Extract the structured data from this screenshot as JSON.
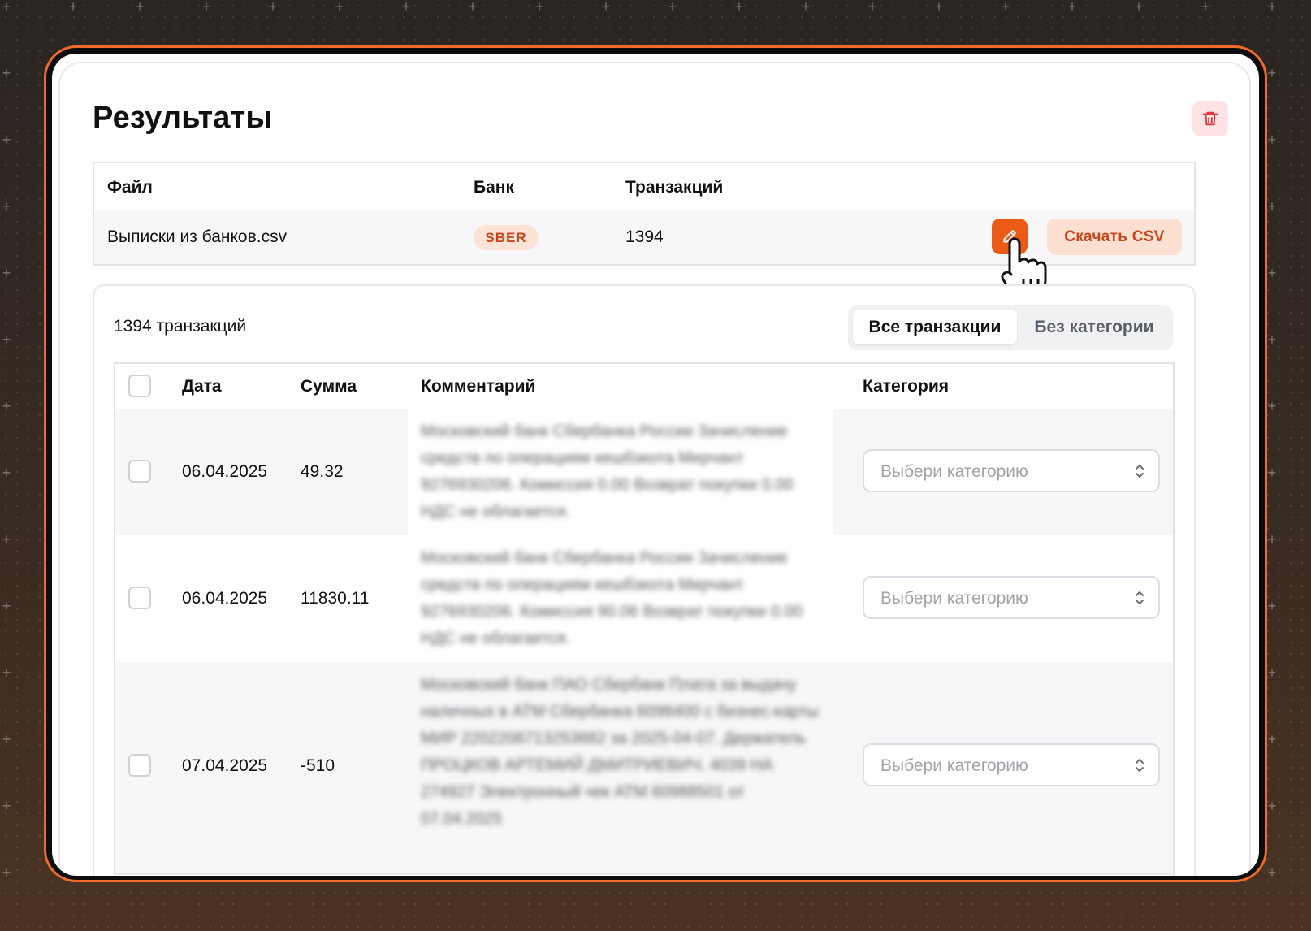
{
  "page": {
    "title": "Результаты"
  },
  "file_table": {
    "columns": [
      "Файл",
      "Банк",
      "Транзакций"
    ],
    "row": {
      "file": "Выписки из банков.csv",
      "bank": "SBER",
      "count": "1394",
      "download_label": "Скачать CSV"
    }
  },
  "transactions": {
    "count_label": "1394 транзакций",
    "tabs": [
      {
        "label": "Все транзакции",
        "active": true
      },
      {
        "label": "Без категории",
        "active": false
      }
    ],
    "columns": [
      "Дата",
      "Сумма",
      "Комментарий",
      "Категория"
    ],
    "rows": [
      {
        "date": "06.04.2025",
        "amount": "49.32",
        "comment": "Московский банк Сбербанка России Зачисление средств по операциям кешбэкота Мерчант 9276930206. Комиссия 0.00 Возврат покупки 0.00 НДС не облагается.",
        "category_placeholder": "Выбери категорию"
      },
      {
        "date": "06.04.2025",
        "amount": "11830.11",
        "comment": "Московский банк Сбербанка России Зачисление средств по операциям кешбэкота Мерчант 9276930206. Комиссия 90.06 Возврат покупки 0.00 НДС не облагается.",
        "category_placeholder": "Выбери категорию"
      },
      {
        "date": "07.04.2025",
        "amount": "-510",
        "comment": "Московский банк ПАО Сбербанк Плата за выдачу наличных в АТМ Сбербанка 6098400 с бизнес-карты МИР 2202206713253682 за 2025-04-07. Держатель ПРОЦКОВ АРТЕМИЙ ДМИТРИЕВИЧ. 4039 НА 274927 Электронный чек АТМ 60988501 от 07.04.2025",
        "category_placeholder": "Выбери категорию"
      }
    ]
  },
  "colors": {
    "accent": "#ec5a17",
    "accent_light": "#fde0d2",
    "danger_light": "#fde3e4",
    "frame": "#ef6b2a"
  }
}
